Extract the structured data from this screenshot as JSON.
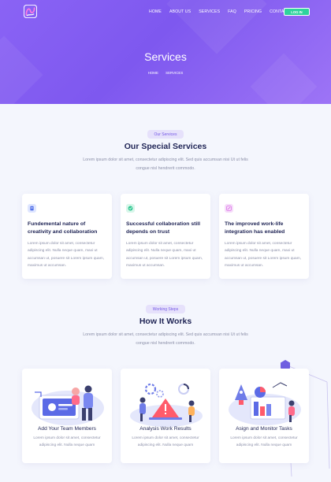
{
  "nav": {
    "items": [
      "HOME",
      "ABOUT US",
      "SERVICES",
      "FAQ",
      "PRICING",
      "CONTACT"
    ],
    "login_label": "LOG IN"
  },
  "hero": {
    "title": "Services",
    "breadcrumb": [
      "HOME",
      "SERVICES"
    ]
  },
  "services_section": {
    "pill": "Our Services",
    "title": "Our Special Services",
    "description": "Lorem ipsum dolor sit amet, consectetur adipiscing elit. Sed quis accumsan nisi Ut ut felis congue nisl hendrerit commodo.",
    "cards": [
      {
        "icon": "document-icon",
        "title": "Fundemental nature of creativity and collaboration",
        "text": "Lorem ipsum dolor sit amet, consectetur adipiscing elit. Nulla neque quam, maxi ut accumsan ut, posuere sit Lorem ipsum quam, maximus ut accumsan."
      },
      {
        "icon": "check-icon",
        "title": "Successful collaboration still depends on trust",
        "text": "Lorem ipsum dolor sit amet, consectetur adipiscing elit. Nulla neque quam, maxi ut accumsan ut, posuere sit Lorem ipsum quam, maximus ut accumsan."
      },
      {
        "icon": "edit-icon",
        "title": "The improved work-life integration has enabled",
        "text": "Lorem ipsum dolor sit amet, consectetur adipiscing elit. Nulla neque quam, maxi ut accumsan ut, posuere sit Lorem ipsum quam, maximus ut accumsan."
      }
    ]
  },
  "steps_section": {
    "pill": "Working Steps",
    "title": "How It Works",
    "description": "Lorem ipsum dolor sit amet, consectetur adipiscing elit. Sed quis accumsan nisi Ut ut felis congue nisl hendrerit commodo.",
    "cards": [
      {
        "title": "Add Your Team Members",
        "text": "Lorem ipsum dolor sit amet, consectetur adipiscing elit. Nulla neque quam"
      },
      {
        "title": "Analysis Work Results",
        "text": "Lorem ipsum dolor sit amet, consectetur adipiscing elit. Nulla neque quam"
      },
      {
        "title": "Asign and Monitor Tasks",
        "text": "Lorem ipsum dolor sit amet, consectetur adipiscing elit. Nulla neque quam"
      }
    ]
  },
  "colors": {
    "hero_gradient_start": "#8a63f5",
    "accent": "#7559e6",
    "login_button": "#2fd39c",
    "heading": "#1f2455",
    "body_text": "#8b8fa8"
  }
}
